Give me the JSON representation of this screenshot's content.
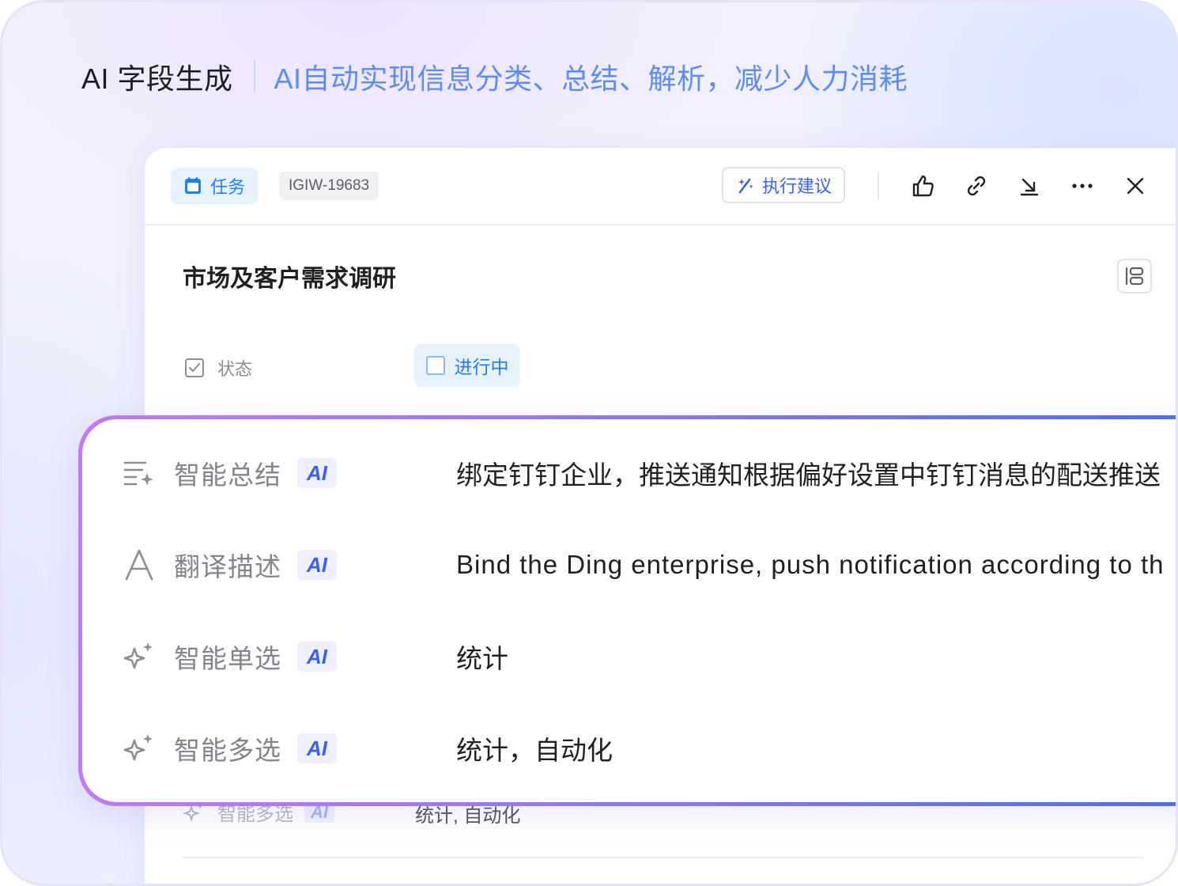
{
  "headline": {
    "title": "AI 字段生成",
    "subtitle": "AI自动实现信息分类、总结、解析，减少人力消耗"
  },
  "card": {
    "type_tag": "任务",
    "id_tag": "IGIW-19683",
    "suggest_button": "执行建议",
    "header_icons": [
      "thumbs-up-icon",
      "link-icon",
      "download-icon",
      "more-icon",
      "close-icon"
    ],
    "title": "市场及客户需求调研",
    "status_label": "状态",
    "status_value": "进行中",
    "ghost_row": {
      "label": "智能多选",
      "badge": "AI",
      "value": "统计, 自动化"
    }
  },
  "ai_panel": {
    "rows": [
      {
        "icon": "summary-sparkle-icon",
        "label": "智能总结",
        "badge": "AI",
        "value": "绑定钉钉企业，推送通知根据偏好设置中钉钉消息的配送推送"
      },
      {
        "icon": "translate-icon",
        "label": "翻译描述",
        "badge": "AI",
        "value": "Bind the Ding enterprise, push notification according to th"
      },
      {
        "icon": "sparkle-icon",
        "label": "智能单选",
        "badge": "AI",
        "value": "统计"
      },
      {
        "icon": "sparkle-icon",
        "label": "智能多选",
        "badge": "AI",
        "value": "统计，自动化"
      }
    ]
  },
  "colors": {
    "accent_blue": "#1e80ff",
    "subtitle_blue": "#5e8cf5",
    "ai_badge": "#3d5ff0",
    "panel_gradient_start": "#c27af5",
    "panel_gradient_end": "#4a6cf0"
  }
}
